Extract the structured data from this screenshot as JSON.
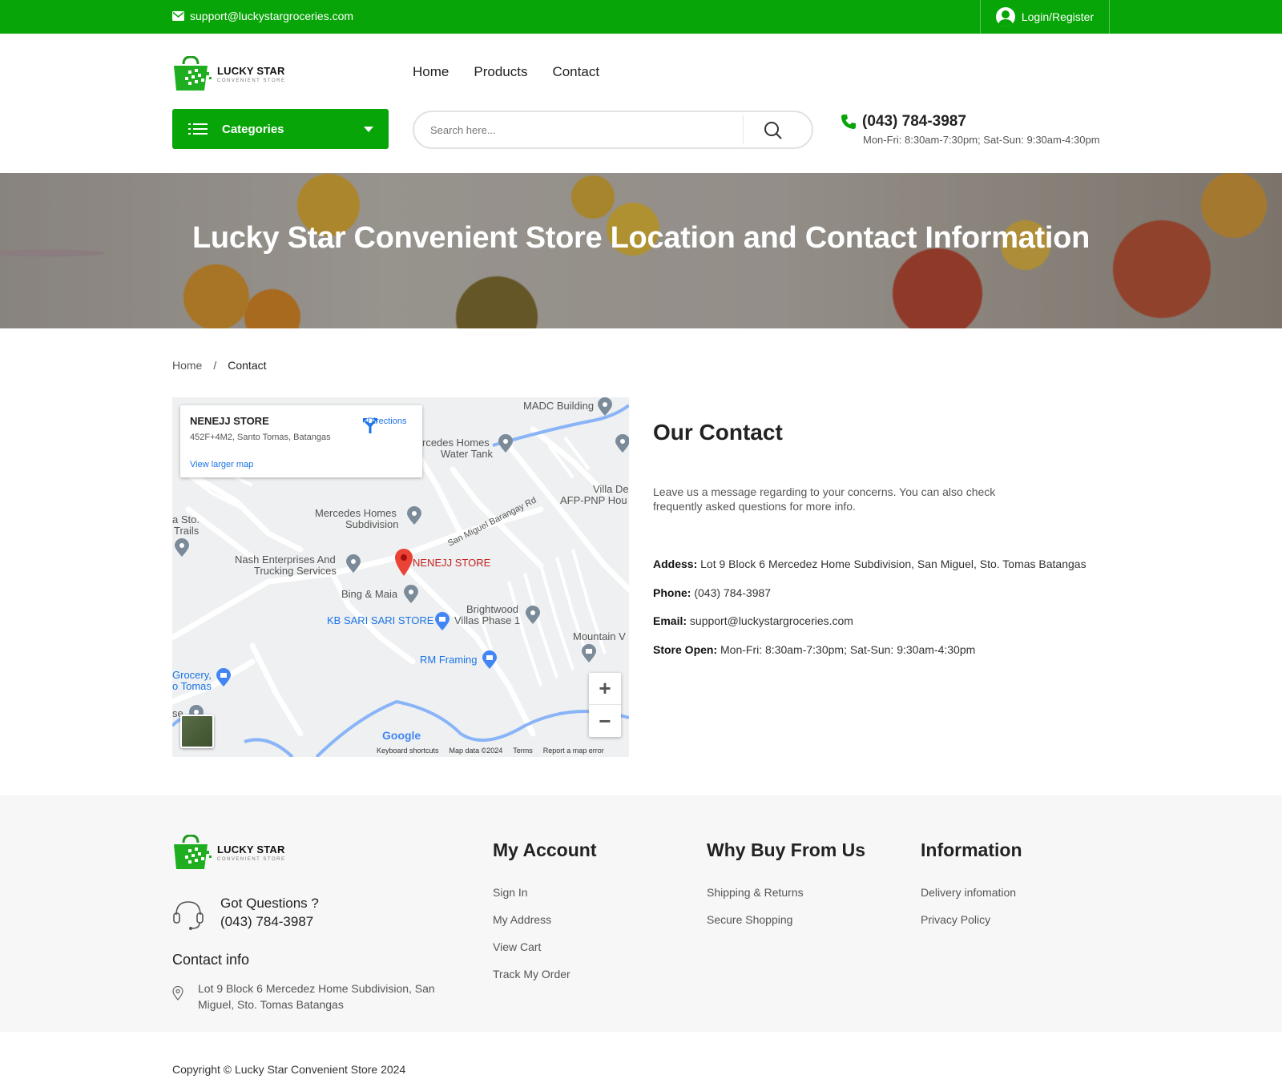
{
  "topbar": {
    "email": "support@luckystargroceries.com",
    "login": "Login/Register"
  },
  "logo": {
    "line1": "LUCKY STAR",
    "line2": "CONVENIENT STORE"
  },
  "nav": [
    "Home",
    "Products",
    "Contact"
  ],
  "categories_label": "Categories",
  "search": {
    "placeholder": "Search here..."
  },
  "phone": {
    "number": "(043) 784-3987",
    "hours": "Mon-Fri: 8:30am-7:30pm; Sat-Sun: 9:30am-4:30pm"
  },
  "banner": {
    "title": "Lucky Star Convenient Store Location and Contact Information"
  },
  "breadcrumb": {
    "home": "Home",
    "separator": "/",
    "current": "Contact"
  },
  "map": {
    "card": {
      "name": "NENEJJ STORE",
      "address": "452F+4M2, Santo Tomas, Batangas",
      "directions": "Directions",
      "view_larger": "View larger map"
    },
    "labels": {
      "madc": "MADC Building",
      "tank1": "rcedes Homes",
      "tank2": "Water Tank",
      "villa1": "Villa De",
      "villa2": "AFP-PNP Hou",
      "sto1": "a Sto.",
      "sto2": "Trails",
      "merc1": "Mercedes Homes",
      "merc2": "Subdivision",
      "road": "San Miguel Barangay Rd",
      "nash1": "Nash Enterprises And",
      "nash2": "Trucking Services",
      "nenejj": "NENEJJ STORE",
      "bing": "Bing & Maia",
      "kb": "KB SARI SARI STORE",
      "bright1": "Brightwood",
      "bright2": "Villas Phase 1",
      "mountain": "Mountain V",
      "rm": "RM Framing",
      "grocery1": "Grocery,",
      "grocery2": "o Tomas",
      "se": "se"
    },
    "zoom_in": "+",
    "zoom_out": "−",
    "google": "Google",
    "attribution": [
      "Keyboard shortcuts",
      "Map data ©2024",
      "Terms",
      "Report a map error"
    ]
  },
  "contact": {
    "title": "Our Contact",
    "description": "Leave us a message regarding to your concerns. You can also check frequently asked questions for more info.",
    "address_label": "Addess:",
    "address": "Lot 9 Block 6 Mercedez Home Subdivision, San Miguel, Sto. Tomas Batangas",
    "phone_label": "Phone:",
    "phone": "(043) 784-3987",
    "email_label": "Email:",
    "email": "support@luckystargroceries.com",
    "open_label": "Store Open:",
    "open": "Mon-Fri: 8:30am-7:30pm; Sat-Sun: 9:30am-4:30pm"
  },
  "footer": {
    "got_questions": "Got Questions ?",
    "phone": "(043) 784-3987",
    "contact_info": "Contact info",
    "address": "Lot 9 Block 6 Mercedez Home Subdivision, San Miguel, Sto. Tomas Batangas",
    "my_account": {
      "title": "My Account",
      "links": [
        "Sign In",
        "My Address",
        "View Cart",
        "Track My Order"
      ]
    },
    "why_buy": {
      "title": "Why Buy From Us",
      "links": [
        "Shipping & Returns",
        "Secure Shopping"
      ]
    },
    "information": {
      "title": "Information",
      "links": [
        "Delivery infomation",
        "Privacy Policy"
      ]
    }
  },
  "copyright": "Copyright © Lucky Star Convenient Store 2024",
  "colors": {
    "brand_green": "#07a507",
    "map_link_blue": "#1a73e8",
    "marker_red": "#ea4335"
  }
}
